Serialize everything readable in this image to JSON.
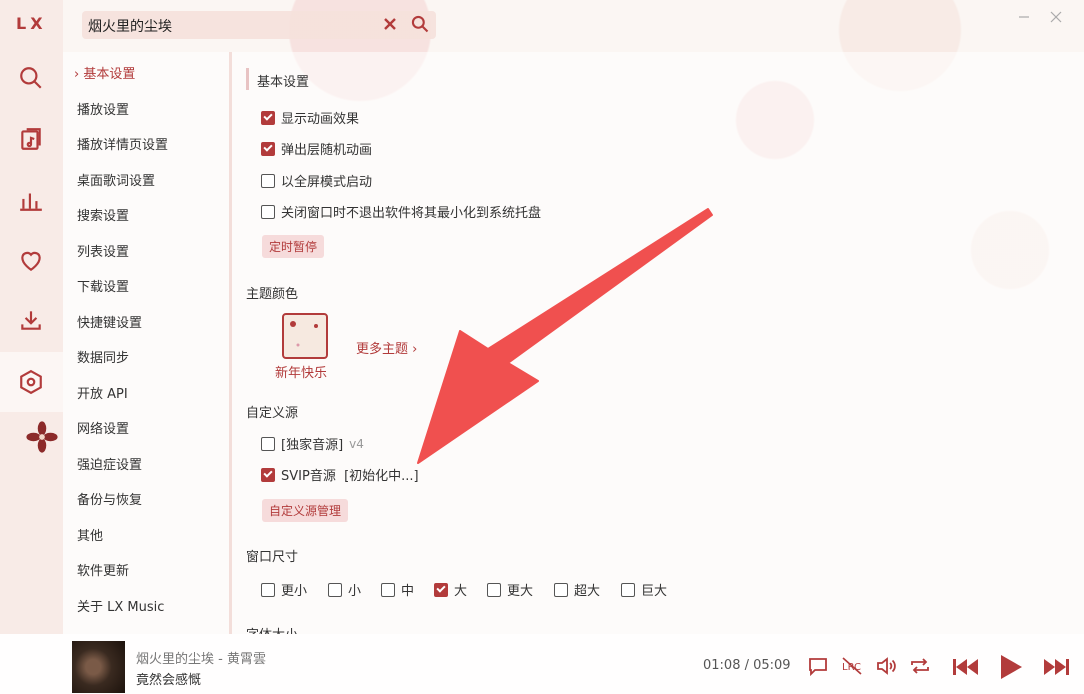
{
  "app": {
    "logo": "LX"
  },
  "search": {
    "value": "烟火里的尘埃"
  },
  "sidebar": {
    "icons": [
      "search-icon",
      "song-list-icon",
      "leaderboard-icon",
      "heart-icon",
      "download-icon",
      "settings-icon"
    ]
  },
  "nav": {
    "items": [
      {
        "label": "基本设置",
        "active": true
      },
      {
        "label": "播放设置"
      },
      {
        "label": "播放详情页设置"
      },
      {
        "label": "桌面歌词设置"
      },
      {
        "label": "搜索设置"
      },
      {
        "label": "列表设置"
      },
      {
        "label": "下载设置"
      },
      {
        "label": "快捷键设置"
      },
      {
        "label": "数据同步"
      },
      {
        "label": "开放 API"
      },
      {
        "label": "网络设置"
      },
      {
        "label": "强迫症设置"
      },
      {
        "label": "备份与恢复"
      },
      {
        "label": "其他"
      },
      {
        "label": "软件更新"
      },
      {
        "label": "关于 LX Music"
      }
    ]
  },
  "basic": {
    "title": "基本设置",
    "options": [
      {
        "label": "显示动画效果",
        "checked": true
      },
      {
        "label": "弹出层随机动画",
        "checked": true
      },
      {
        "label": "以全屏模式启动",
        "checked": false
      },
      {
        "label": "关闭窗口时不退出软件将其最小化到系统托盘",
        "checked": false
      }
    ],
    "timer_button": "定时暂停"
  },
  "theme": {
    "title": "主题颜色",
    "current": "新年快乐",
    "more": "更多主题"
  },
  "custom_source": {
    "title": "自定义源",
    "items": [
      {
        "label": "[独家音源]",
        "version": "v4",
        "checked": false
      },
      {
        "label": "SVIP音源  [初始化中...]",
        "version": "",
        "checked": true
      }
    ],
    "manage_button": "自定义源管理"
  },
  "window_size": {
    "title": "窗口尺寸",
    "options": [
      {
        "label": "更小",
        "checked": false
      },
      {
        "label": "小",
        "checked": false
      },
      {
        "label": "中",
        "checked": false
      },
      {
        "label": "大",
        "checked": true
      },
      {
        "label": "更大",
        "checked": false
      },
      {
        "label": "超大",
        "checked": false
      },
      {
        "label": "巨大",
        "checked": false
      }
    ]
  },
  "font_size": {
    "title": "字体大小"
  },
  "player": {
    "song": "烟火里的尘埃 - 黄霄雲",
    "lyric": "竟然会感慨",
    "time": "01:08 / 05:09"
  },
  "colors": {
    "accent": "#b23b3b",
    "arrow": "#f0504f"
  }
}
